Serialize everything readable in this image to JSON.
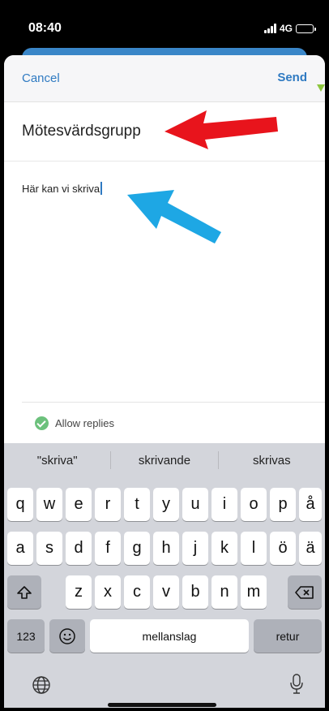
{
  "status_bar": {
    "time": "08:40",
    "network": "4G"
  },
  "header": {
    "cancel_label": "Cancel",
    "send_label": "Send"
  },
  "compose": {
    "group_name": "Mötesvärdsgrupp",
    "message_text": "Här kan vi skriva"
  },
  "options": {
    "allow_replies_label": "Allow replies",
    "allow_replies_checked": true
  },
  "keyboard": {
    "suggestions": [
      "\"skriva\"",
      "skrivande",
      "skrivas"
    ],
    "row1": [
      "q",
      "w",
      "e",
      "r",
      "t",
      "y",
      "u",
      "i",
      "o",
      "p",
      "å"
    ],
    "row2": [
      "a",
      "s",
      "d",
      "f",
      "g",
      "h",
      "j",
      "k",
      "l",
      "ö",
      "ä"
    ],
    "row3": [
      "z",
      "x",
      "c",
      "v",
      "b",
      "n",
      "m"
    ],
    "numbers_label": "123",
    "space_label": "mellanslag",
    "return_label": "retur"
  },
  "colors": {
    "accent": "#2f7ac2",
    "red_arrow": "#e8141c",
    "blue_arrow": "#1ea7e4",
    "check": "#6cc17c"
  },
  "icons": [
    "signal-icon",
    "battery-charging-icon",
    "check-circle-icon",
    "shift-icon",
    "backspace-icon",
    "emoji-icon",
    "globe-icon",
    "microphone-icon"
  ]
}
